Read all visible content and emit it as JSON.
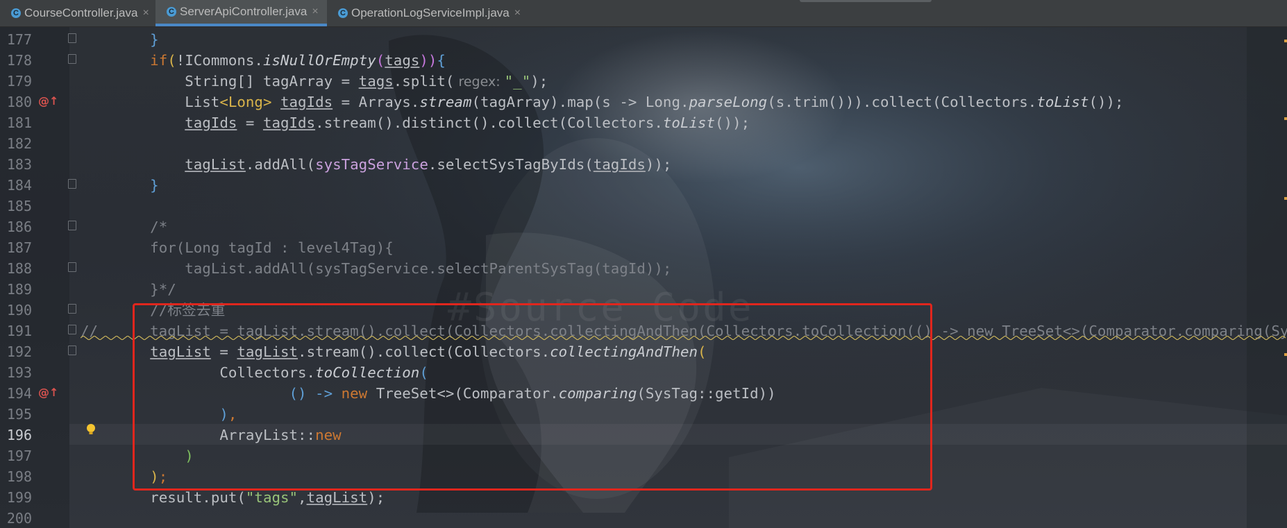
{
  "tabs": [
    {
      "label": "CourseController.java",
      "icon": "C",
      "active": false
    },
    {
      "label": "ServerApiController.java",
      "icon": "C",
      "active": true
    },
    {
      "label": "OperationLogServiceImpl.java",
      "icon": "C",
      "active": false
    }
  ],
  "tab_close_glyph": "×",
  "line_numbers": [
    "177",
    "178",
    "179",
    "180",
    "181",
    "182",
    "183",
    "184",
    "185",
    "186",
    "187",
    "188",
    "189",
    "190",
    "191",
    "192",
    "193",
    "194",
    "195",
    "196",
    "197",
    "198",
    "199",
    "200"
  ],
  "current_line": "196",
  "watermark": "#Source Code",
  "code": {
    "l177": {
      "brace": "}"
    },
    "l178": {
      "kw": "if",
      "p1": "(",
      "a": "!ICommons.",
      "fn": "isNullOrEmpty",
      "p2": "(",
      "b": "tags",
      "p3": "))",
      "c": "{"
    },
    "l179": {
      "a": "String[] tagArray = ",
      "b": "tags",
      "c": ".split(",
      "hint": " regex: ",
      "str": "\"_\"",
      "d": ");"
    },
    "l180": {
      "a": "List",
      "b": "<Long>",
      "c": " ",
      "d": "tagIds",
      "e": " = Arrays.",
      "fn1": "stream",
      "f": "(tagArray).map(s -> Long.",
      "fn2": "parseLong",
      "g": "(s.trim())).collect(Collectors.",
      "fn3": "toList",
      "h": "());"
    },
    "l181": {
      "a": "tagIds",
      "b": " = ",
      "c": "tagIds",
      "d": ".stream().distinct().collect(Collectors.",
      "fn": "toList",
      "e": "());"
    },
    "l183": {
      "a": "tagList",
      "b": ".addAll(",
      "c": "sysTagService",
      "d": ".selectSysTagByIds(",
      "e": "tagIds",
      "f": "));"
    },
    "l184": {
      "brace": "}"
    },
    "l186": {
      "text": "/*"
    },
    "l187": {
      "text": "for(Long tagId : level4Tag){"
    },
    "l188": {
      "text": "    tagList.addAll(sysTagService.selectParentSysTag(tagId));"
    },
    "l189": {
      "text": "}*/"
    },
    "l190": {
      "text": "//标签去重"
    },
    "l191": {
      "text": "//      tagList = tagList.stream().collect(Collectors.collectingAndThen(Collectors.toCollection(() -> new TreeSet<>(Comparator.comparing(SysTag::getId))), ArrayList::new));"
    },
    "l192": {
      "a": "tagList",
      "b": " = ",
      "c": "tagList",
      "d": ".stream().collect(Collectors.",
      "fn": "collectingAndThen",
      "e": "("
    },
    "l193": {
      "a": "Collectors.",
      "fn": "toCollection",
      "b": "("
    },
    "l194": {
      "a": "() -> ",
      "kw": "new",
      "b": " TreeSet<>(Comparator.",
      "fn": "comparing",
      "c": "(SysTag::getId))"
    },
    "l195": {
      "a": ")",
      "b": ","
    },
    "l196": {
      "a": "ArrayList::",
      "kw": "new"
    },
    "l197": {
      "a": ")"
    },
    "l198": {
      "a": ")",
      "b": ";"
    },
    "l199": {
      "a": "result.put(",
      "str": "\"tags\"",
      "b": ",",
      "c": "tagList",
      "d": ");"
    }
  }
}
